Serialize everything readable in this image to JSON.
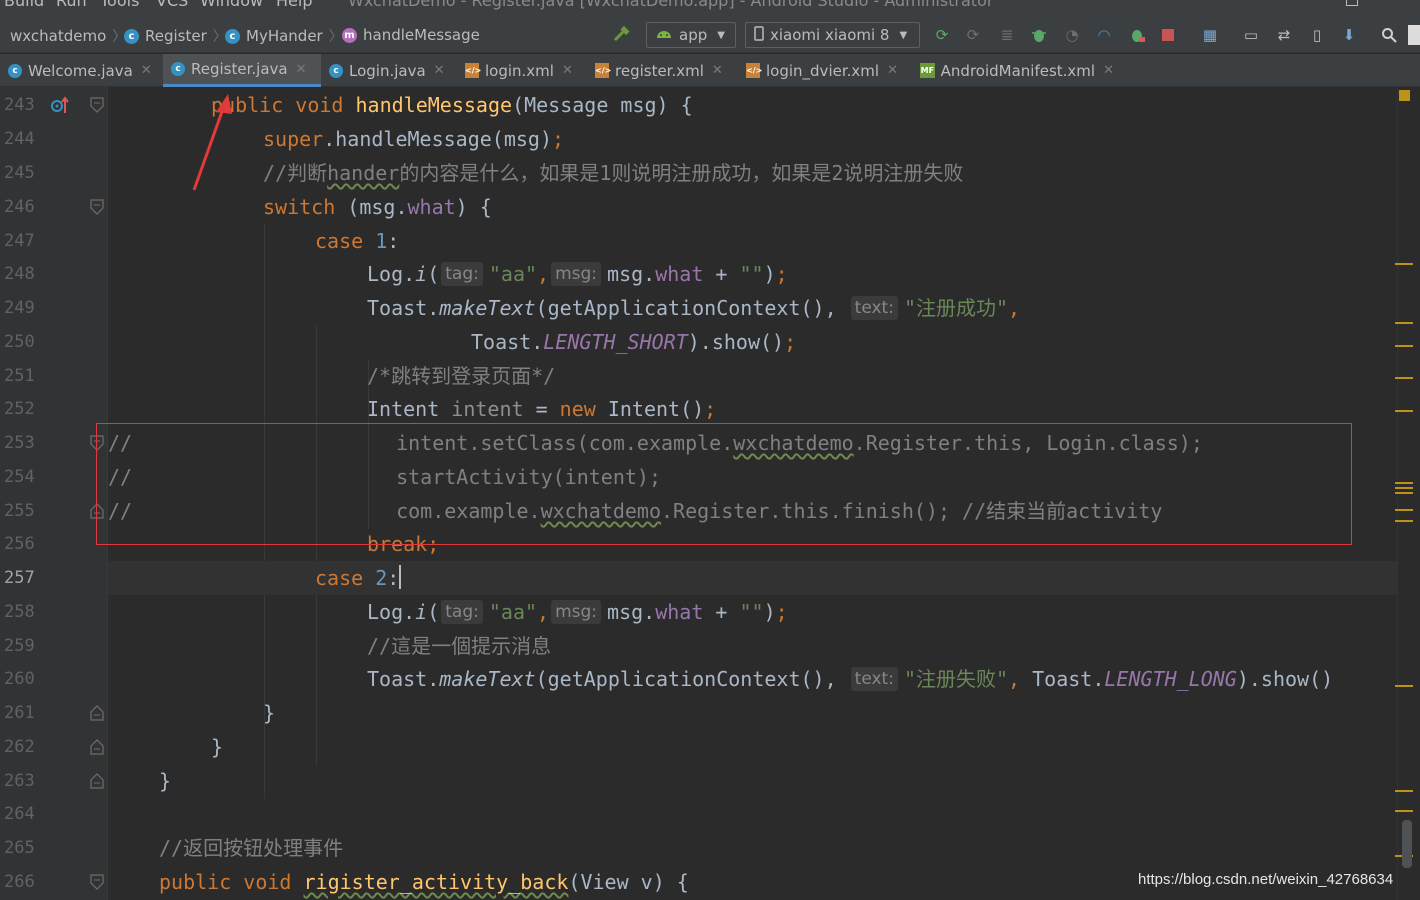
{
  "menu": {
    "items": [
      "Build",
      "Run",
      "Tools",
      "VCS",
      "Window",
      "Help"
    ],
    "window_title": "WxchatDemo - Register.java [WxchatDemo.app] - Android Studio - Administrator"
  },
  "breadcrumbs": [
    {
      "label": "wxchatdemo",
      "icon": "none"
    },
    {
      "label": "Register",
      "icon": "class-icon"
    },
    {
      "label": "MyHander",
      "icon": "class-icon"
    },
    {
      "label": "handleMessage",
      "icon": "method-icon"
    }
  ],
  "toolbar": {
    "run_config": "app",
    "device": "xiaomi xiaomi 8"
  },
  "tabs": [
    {
      "label": "Welcome.java",
      "type": "java",
      "active": false
    },
    {
      "label": "Register.java",
      "type": "java",
      "active": true
    },
    {
      "label": "Login.java",
      "type": "java",
      "active": false
    },
    {
      "label": "login.xml",
      "type": "xml",
      "active": false
    },
    {
      "label": "register.xml",
      "type": "xml",
      "active": false
    },
    {
      "label": "login_dvier.xml",
      "type": "xml",
      "active": false
    },
    {
      "label": "AndroidManifest.xml",
      "type": "manifest",
      "active": false
    }
  ],
  "line_numbers": [
    "243",
    "244",
    "245",
    "246",
    "247",
    "248",
    "249",
    "250",
    "251",
    "252",
    "253",
    "254",
    "255",
    "256",
    "257",
    "258",
    "259",
    "260",
    "261",
    "262",
    "263",
    "264",
    "265",
    "266"
  ],
  "current_line": "257",
  "code": {
    "l243": {
      "kw1": "public",
      "kw2": "void",
      "fn": "handleMessage",
      "rest": "(Message msg) {"
    },
    "l244": {
      "kw": "super",
      "rest": ".handleMessage(msg)",
      "semi": ";"
    },
    "l245": {
      "comment_a": "//判断",
      "comment_b": "hander",
      "comment_c": "的内容是什么，如果是1则说明注册成功，如果是2说明注册失败"
    },
    "l246": {
      "kw": "switch",
      "a": " (msg.",
      "fld": "what",
      "b": ") {"
    },
    "l247": {
      "kw": "case",
      "num": "1",
      "colon": ":"
    },
    "l248": {
      "a": "Log.",
      "fn": "i",
      "b": "(",
      "hint1": "tag:",
      "str1": "\"aa\"",
      "c": ",",
      "hint2": "msg:",
      "d": "msg.",
      "fld": "what",
      "e": " + ",
      "str2": "\"\"",
      "f": ")",
      "semi": ";"
    },
    "l249": {
      "a": "Toast.",
      "fn": "makeText",
      "b": "(getApplicationContext(),",
      "hint": "text:",
      "str": "\"注册成功\"",
      "c": ","
    },
    "l250": {
      "a": "Toast.",
      "sfld": "LENGTH_SHORT",
      "b": ").show()",
      "semi": ";"
    },
    "l251": {
      "comment": "/*跳转到登录页面*/"
    },
    "l252": {
      "a": "Intent ",
      "var": "intent",
      "b": " = ",
      "kw": "new",
      "c": " Intent()",
      "semi": ";"
    },
    "l253": {
      "prefix": "//",
      "a": "intent.setClass(com.example.",
      "wavy": "wxchatdemo",
      "b": ".Register.this, Login.class);"
    },
    "l254": {
      "prefix": "//",
      "a": "startActivity(intent);"
    },
    "l255": {
      "prefix": "//",
      "a": "com.example.",
      "wavy": "wxchatdemo",
      "b": ".Register.this.finish(); //结束当前activity"
    },
    "l256": {
      "kw": "break",
      "semi": ";"
    },
    "l257": {
      "kw": "case",
      "num": "2",
      "colon": ":"
    },
    "l258": {
      "a": "Log.",
      "fn": "i",
      "b": "(",
      "hint1": "tag:",
      "str1": "\"aa\"",
      "c": ",",
      "hint2": "msg:",
      "d": "msg.",
      "fld": "what",
      "e": " + ",
      "str2": "\"\"",
      "f": ")",
      "semi": ";"
    },
    "l259": {
      "comment": "//這是一個提示消息"
    },
    "l260": {
      "a": "Toast.",
      "fn": "makeText",
      "b": "(getApplicationContext(),",
      "hint": "text:",
      "str": "\"注册失败\"",
      "c": ",",
      "d": " Toast.",
      "sfld": "LENGTH_LONG",
      "e": ").show()"
    },
    "l261": {
      "a": "}"
    },
    "l262": {
      "a": "}"
    },
    "l263": {
      "a": "}"
    },
    "l265": {
      "comment": "//返回按钮处理事件"
    },
    "l266": {
      "kw1": "public",
      "kw2": "void",
      "fn": "rigister_activity_back",
      "rest": "(View v) {"
    }
  },
  "watermark": "https://blog.csdn.net/weixin_42768634",
  "colors": {
    "keyword": "#cc7832",
    "function": "#ffc66d",
    "string": "#6a8759",
    "number": "#6897bb",
    "comment": "#808080",
    "field": "#9876aa",
    "annotation_box": "#e03a3a",
    "active_tab_underline": "#4a88c7"
  }
}
